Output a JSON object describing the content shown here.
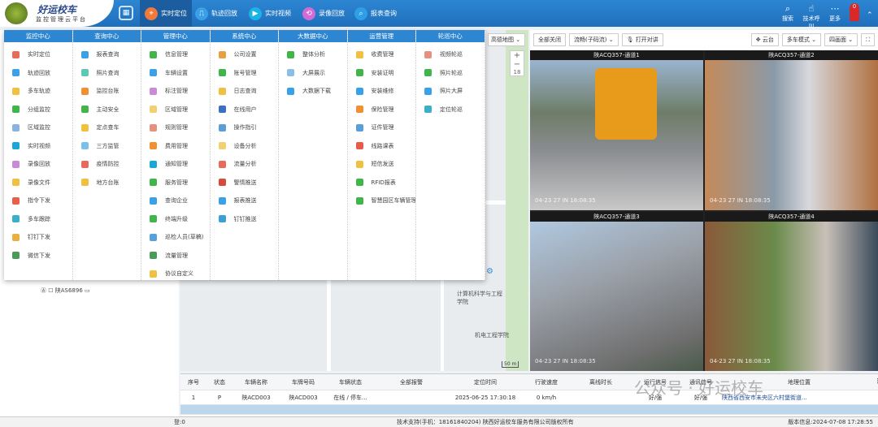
{
  "header": {
    "logo_title": "好运校车",
    "logo_subtitle": "监控管理云平台",
    "logo_badge": "好运校车",
    "nav": [
      {
        "label": "实时定位",
        "icon": "location-pin-icon",
        "color": "#f07a3c"
      },
      {
        "label": "轨迹回放",
        "icon": "track-icon",
        "color": "#3aa0e8"
      },
      {
        "label": "实时视频",
        "icon": "play-icon",
        "color": "#19b4e6"
      },
      {
        "label": "录像回放",
        "icon": "replay-icon",
        "color": "#d36bd6"
      },
      {
        "label": "报表查询",
        "icon": "search-report-icon",
        "color": "#2e9ee6"
      }
    ],
    "tools": [
      {
        "label": "搜索",
        "icon": "search-icon"
      },
      {
        "label": "技术呼叫",
        "icon": "hand-icon"
      },
      {
        "label": "更多",
        "icon": "more-icon"
      }
    ],
    "alarm_count": "0"
  },
  "menu": [
    {
      "title": "监控中心",
      "items": [
        "实时定位",
        "轨迹回放",
        "多车轨迹",
        "分组监控",
        "区域监控",
        "实时视频",
        "录像回放",
        "录像文件",
        "指令下发",
        "多车跟踪",
        "钉钉下发",
        "微信下发"
      ],
      "colors": [
        "#e86a5a",
        "#3aa0e8",
        "#f0c040",
        "#3fb54a",
        "#8ab4e0",
        "#19a7d9",
        "#c98ad8",
        "#f0c040",
        "#e8604a",
        "#3ab0c8",
        "#e8b040",
        "#4a9a5a"
      ]
    },
    {
      "title": "查询中心",
      "items": [
        "报表查询",
        "照片查询",
        "监控台账",
        "主动安全",
        "定点查车",
        "三方监管",
        "疫情防控",
        "地方台账"
      ],
      "colors": [
        "#3aa0e8",
        "#5cc8b8",
        "#f09030",
        "#3fb54a",
        "#f0c040",
        "#7ac0e8",
        "#e86a5a",
        "#f0c040"
      ]
    },
    {
      "title": "管理中心",
      "items": [
        "信息管理",
        "车辆设置",
        "标注管理",
        "区域管理",
        "规则管理",
        "费用管理",
        "通知管理",
        "服务管理",
        "查询企业",
        "终端升级",
        "巡检人员(草稿)",
        "流量管理",
        "协议自定义"
      ],
      "colors": [
        "#3fb54a",
        "#3aa0e8",
        "#c98ad8",
        "#f0d070",
        "#e89080",
        "#f09030",
        "#19a7d9",
        "#3fb54a",
        "#3aa0e8",
        "#3fb54a",
        "#5aa0d8",
        "#4a9a5a",
        "#f0c040"
      ]
    },
    {
      "title": "系统中心",
      "items": [
        "公司设置",
        "账号管理",
        "日志查询",
        "在线用户",
        "操作指引",
        "设备分析",
        "流量分析",
        "警情推送",
        "报表推送",
        "钉钉推送"
      ],
      "colors": [
        "#e8a040",
        "#3fb54a",
        "#f0c040",
        "#3a70c8",
        "#5aa0d8",
        "#f0d070",
        "#e86a5a",
        "#d84a3a",
        "#3aa0e8",
        "#3aa0d8"
      ]
    },
    {
      "title": "大数据中心",
      "items": [
        "整体分析",
        "大屏展示",
        "大数据下载"
      ],
      "colors": [
        "#3fb54a",
        "#8ac0e8",
        "#3aa0e8"
      ]
    },
    {
      "title": "运营管理",
      "items": [
        "收费管理",
        "安装证明",
        "安装维修",
        "保险管理",
        "证件管理",
        "线路课表",
        "短信发送",
        "RFID报表",
        "智慧园区车辆管理"
      ],
      "colors": [
        "#f0c040",
        "#3fb54a",
        "#3aa0e8",
        "#f09030",
        "#5aa0d8",
        "#e85a4a",
        "#f0c040",
        "#3fb54a",
        "#3fb54a"
      ]
    },
    {
      "title": "轮巡中心",
      "items": [
        "视频轮巡",
        "照片轮巡",
        "照片大屏",
        "定位轮巡"
      ],
      "colors": [
        "#e89080",
        "#3fb54a",
        "#3aa0e8",
        "#3ab0c8"
      ]
    }
  ],
  "left_tree": {
    "vehicle": "陕AS6896"
  },
  "map": {
    "layer_select": "高德地图",
    "zoom_level": "18",
    "scale": "50 m",
    "labels": [
      "计算机科学与工程学院",
      "机电工程学院"
    ]
  },
  "video": {
    "toolbar": {
      "close_all": "全部关闭",
      "stream": "流畅(子码流)",
      "intercom": "打开对讲",
      "ptz": "云台",
      "mode": "多车模式",
      "layout": "四画面"
    },
    "tiles": [
      {
        "title": "陕ACQ357-通道1",
        "time": "04-23 27 IN 18:08:35"
      },
      {
        "title": "陕ACQ357-通道2",
        "time": "04-23 27 IN 18:08:35"
      },
      {
        "title": "陕ACQ357-通道3",
        "time": "04-23 27 IN 18:08:35"
      },
      {
        "title": "陕ACQ357-通道4",
        "time": "04-23 27 IN 18:08:35"
      }
    ]
  },
  "table": {
    "columns": [
      "序号",
      "状态",
      "车辆名称",
      "车牌号码",
      "车辆状态",
      "全部报警",
      "定位时间",
      "行驶速度",
      "离线时长",
      "运行信号",
      "通讯信号",
      "地理位置"
    ],
    "rows": [
      [
        "1",
        "P",
        "陕ACD003",
        "陕ACD003",
        "在线 / 停车...",
        "",
        "2025-06-25 17:30:18",
        "0 km/h",
        "",
        "好/强",
        "好/强",
        "陕西省西安市未央区六村堡街道..."
      ]
    ]
  },
  "watermark": "公众号 · 好运校车",
  "footer": {
    "left": "登:0",
    "support": "技术支持(手机：18161840204) 陕西好运校车服务有限公司版权所有",
    "version": "版本信息:2024-07-08 17:28:55"
  }
}
